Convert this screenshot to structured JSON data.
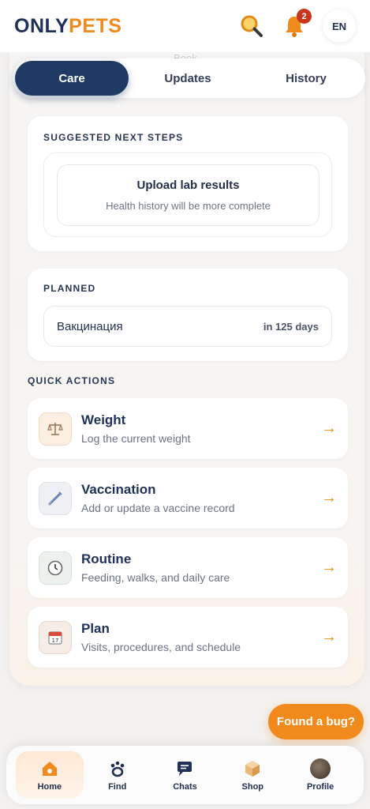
{
  "header": {
    "logo_prefix": "ONLY",
    "logo_suffix": "PETS",
    "notification_count": "2",
    "language": "EN"
  },
  "ghost_text": "Book",
  "tabs": [
    {
      "label": "Care",
      "active": true
    },
    {
      "label": "Updates",
      "active": false
    },
    {
      "label": "History",
      "active": false
    }
  ],
  "suggested": {
    "title": "SUGGESTED NEXT STEPS",
    "item_title": "Upload lab results",
    "item_subtitle": "Health history will be more complete"
  },
  "planned": {
    "title": "PLANNED",
    "item_name": "Вакцинация",
    "item_when": "in 125 days"
  },
  "quick_actions": {
    "title": "QUICK ACTIONS",
    "items": [
      {
        "title": "Weight",
        "subtitle": "Log the current weight",
        "icon": "scale-icon",
        "glyph": "⚖",
        "bg": "#fdeee2"
      },
      {
        "title": "Vaccination",
        "subtitle": "Add or update a vaccine record",
        "icon": "syringe-icon",
        "glyph": "💉",
        "bg": "#eef0f4"
      },
      {
        "title": "Routine",
        "subtitle": "Feeding, walks, and daily care",
        "icon": "clock-icon",
        "glyph": "🕒",
        "bg": "#edf1ee"
      },
      {
        "title": "Plan",
        "subtitle": "Visits, procedures, and schedule",
        "icon": "calendar-icon",
        "glyph": "📅",
        "bg": "#f6ece6"
      }
    ]
  },
  "bug_button": "Found a bug?",
  "bottom_nav": [
    {
      "label": "Home",
      "icon": "home-icon",
      "active": true
    },
    {
      "label": "Find",
      "icon": "paw-icon",
      "active": false
    },
    {
      "label": "Chats",
      "icon": "chat-icon",
      "active": false
    },
    {
      "label": "Shop",
      "icon": "box-icon",
      "active": false
    },
    {
      "label": "Profile",
      "icon": "avatar",
      "active": false
    }
  ],
  "colors": {
    "accent": "#f08a1c",
    "primary": "#1f3b64",
    "badge": "#c8361c"
  }
}
